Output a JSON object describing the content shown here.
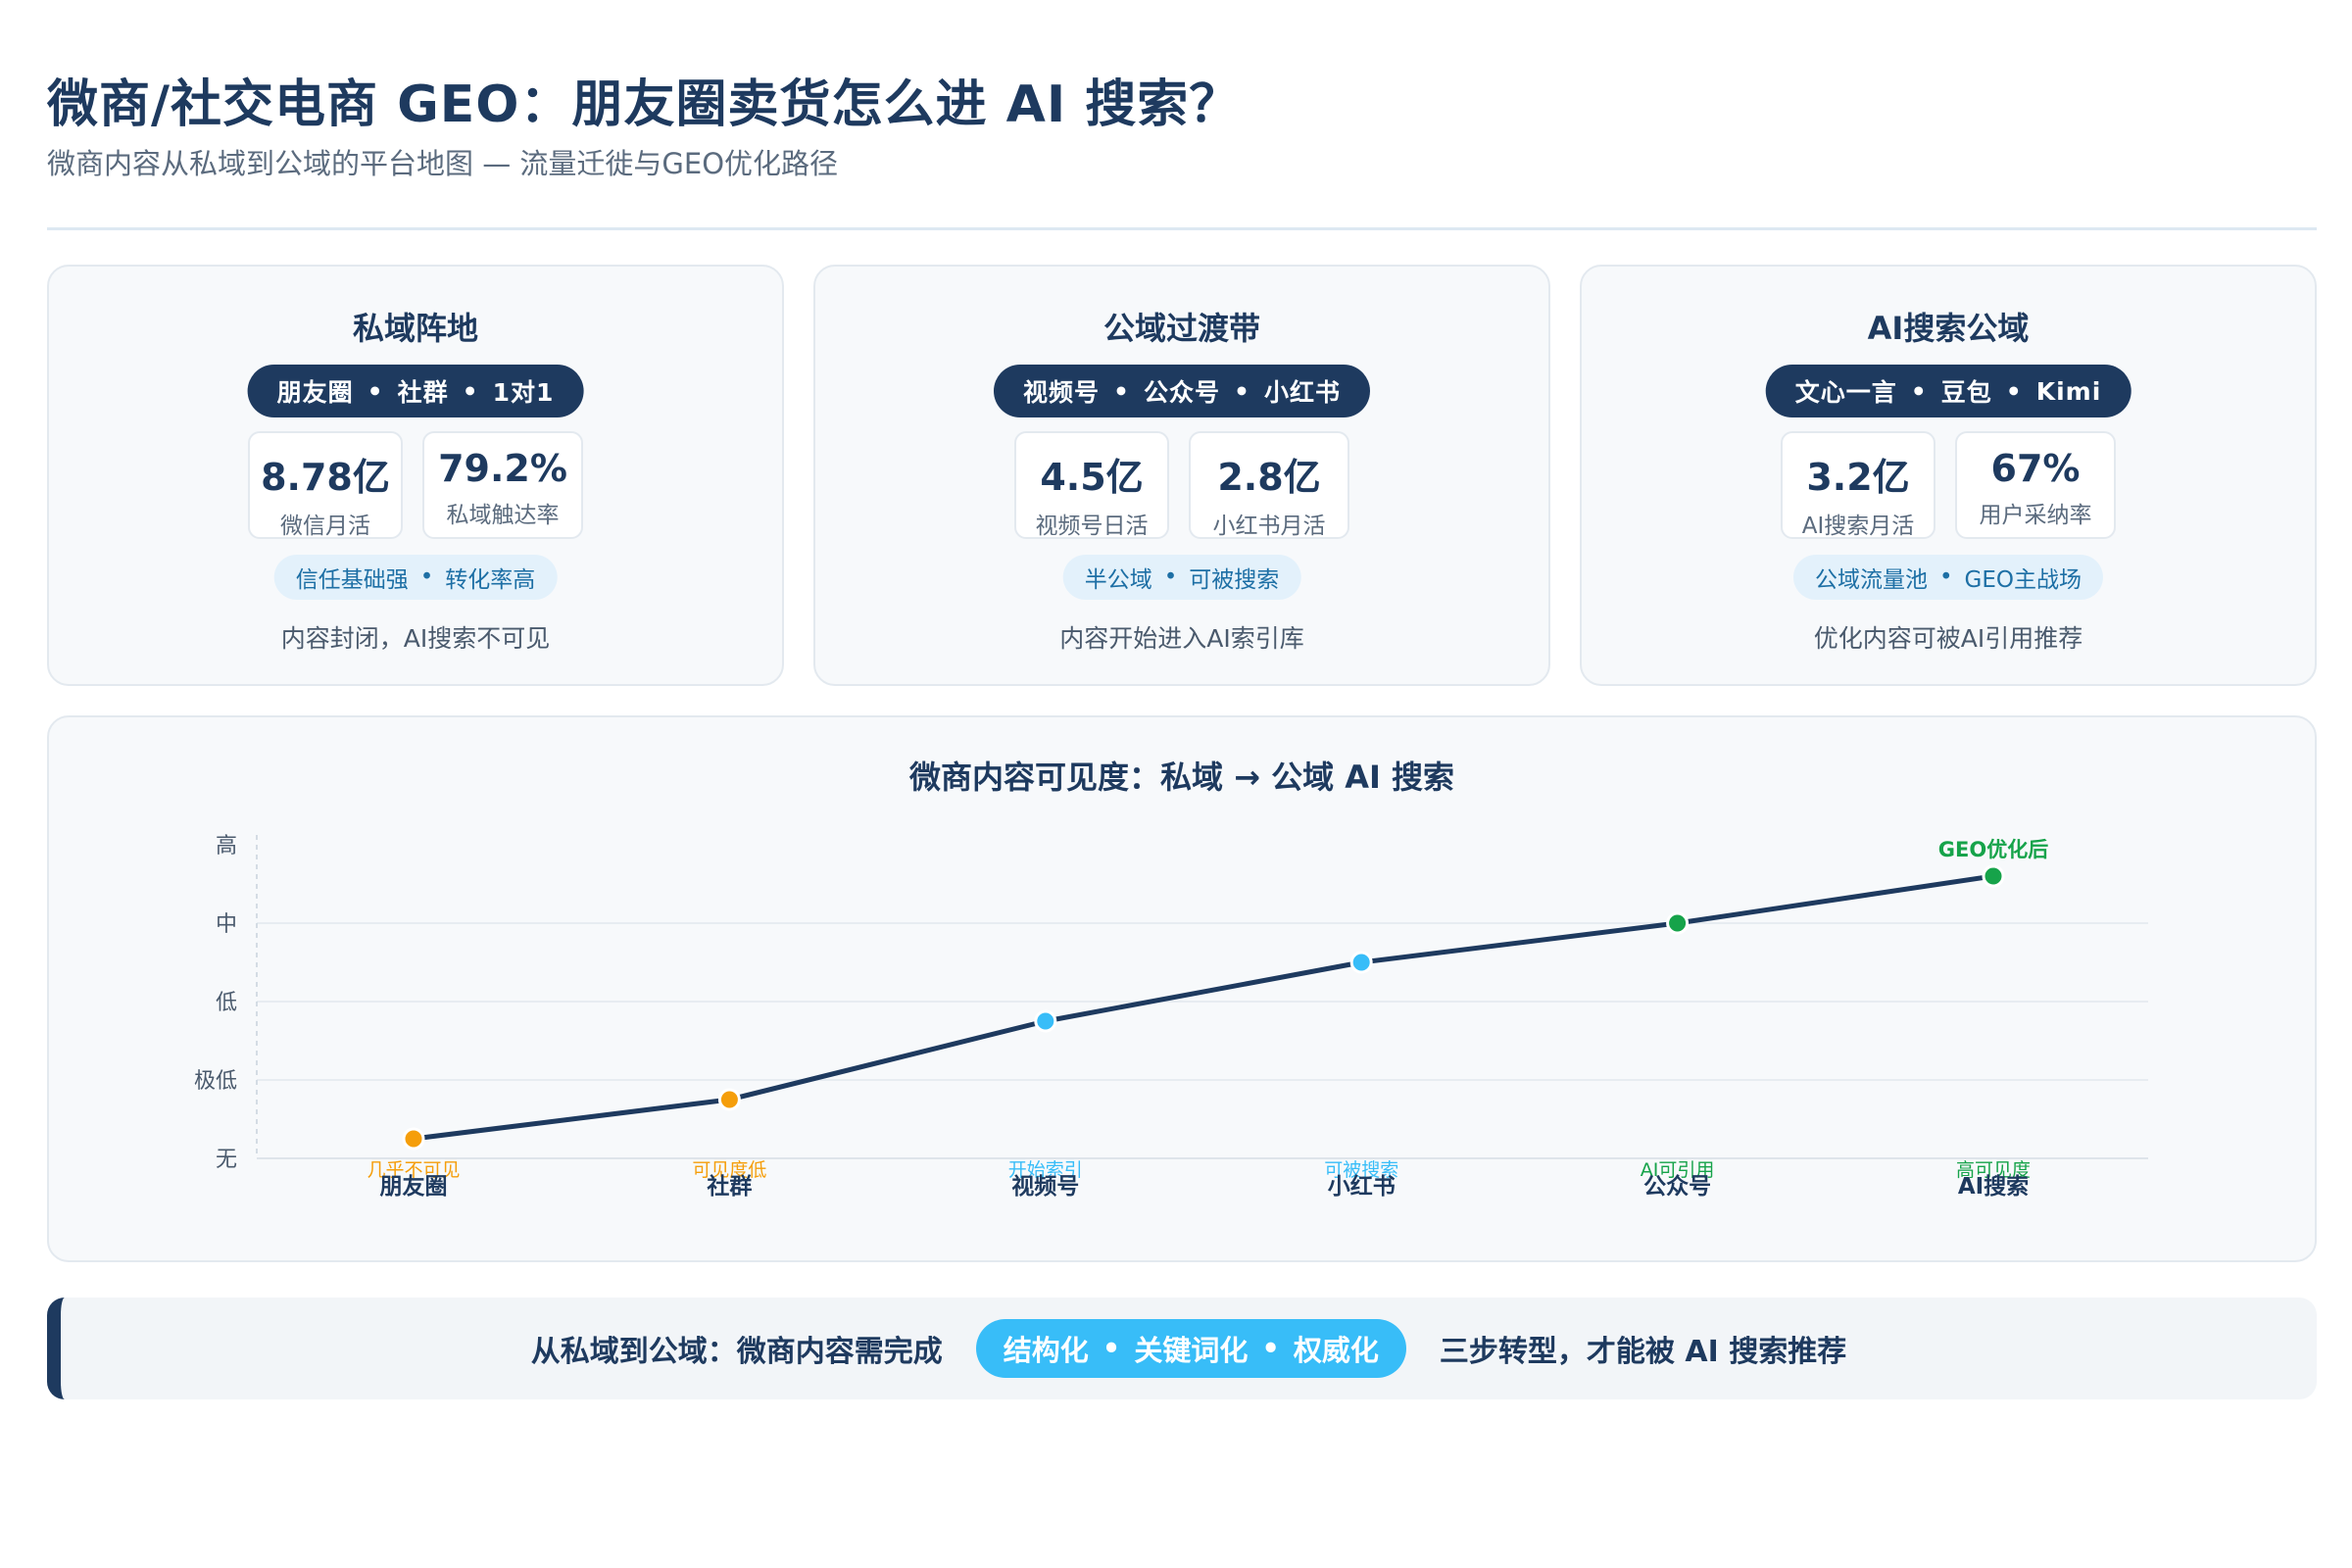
{
  "header": {
    "title": "微商/社交电商 GEO：朋友圈卖货怎么进 AI 搜索？",
    "subtitle": "微商内容从私域到公域的平台地图 — 流量迁徙与GEO优化路径"
  },
  "cards": [
    {
      "title": "私域阵地",
      "platforms": [
        "朋友圈",
        "社群",
        "1对1"
      ],
      "stats": [
        {
          "value": "8.78亿",
          "label": "微信月活"
        },
        {
          "value": "79.2%",
          "label": "私域触达率"
        }
      ],
      "tags": [
        "信任基础强",
        "转化率高"
      ],
      "desc": "内容封闭，AI搜索不可见"
    },
    {
      "title": "公域过渡带",
      "platforms": [
        "视频号",
        "公众号",
        "小红书"
      ],
      "stats": [
        {
          "value": "4.5亿",
          "label": "视频号日活"
        },
        {
          "value": "2.8亿",
          "label": "小红书月活"
        }
      ],
      "tags": [
        "半公域",
        "可被搜索"
      ],
      "desc": "内容开始进入AI索引库"
    },
    {
      "title": "AI搜索公域",
      "platforms": [
        "文心一言",
        "豆包",
        "Kimi"
      ],
      "stats": [
        {
          "value": "3.2亿",
          "label": "AI搜索月活"
        },
        {
          "value": "67%",
          "label": "用户采纳率"
        }
      ],
      "tags": [
        "公域流量池",
        "GEO主战场"
      ],
      "desc": "优化内容可被AI引用推荐"
    }
  ],
  "chart_data": {
    "type": "line",
    "title": "微商内容可见度：私域 → 公域 AI 搜索",
    "categories": [
      "朋友圈",
      "社群",
      "视频号",
      "小红书",
      "公众号",
      "AI搜索"
    ],
    "y_levels": [
      "无",
      "极低",
      "低",
      "中",
      "高"
    ],
    "values": [
      0.25,
      0.75,
      1.75,
      2.5,
      3.0,
      3.6
    ],
    "ylim": [
      0,
      4
    ],
    "point_labels": [
      "几乎不可见",
      "可见度低",
      "开始索引",
      "可被搜索",
      "AI可引用",
      "高可见度"
    ],
    "point_colors": [
      "#f59e0b",
      "#f59e0b",
      "#38bdf8",
      "#38bdf8",
      "#16a34a",
      "#16a34a"
    ],
    "line_color": "#1e3a5f",
    "annotation": {
      "index": 5,
      "text": "GEO优化后",
      "color": "#16a34a"
    },
    "grid": true
  },
  "banner": {
    "lead": "从私域到公域：微商内容需完成",
    "steps": [
      "结构化",
      "关键词化",
      "权威化"
    ],
    "tail": "三步转型，才能被 AI 搜索推荐"
  },
  "separator": "•"
}
